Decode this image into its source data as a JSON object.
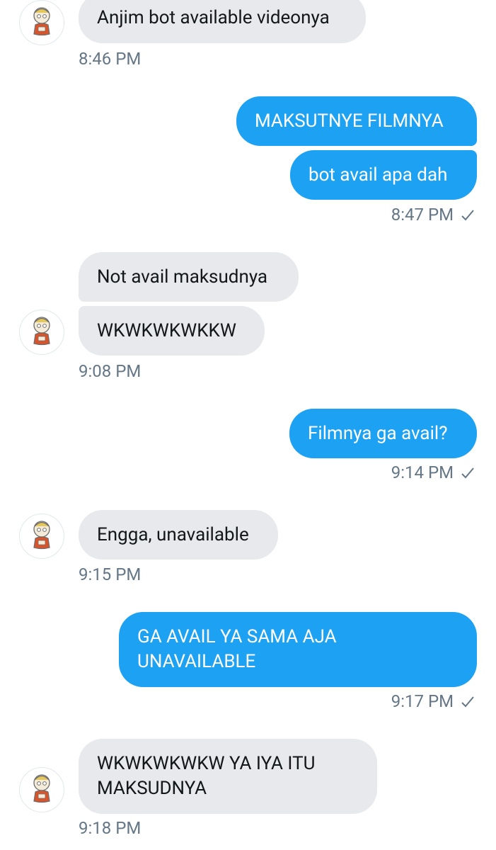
{
  "messages": [
    {
      "id": "m1",
      "side": "received",
      "text": "Anjim bot available videonya"
    },
    {
      "id": "m2",
      "side": "sent",
      "text": "MAKSUTNYE FILMNYA"
    },
    {
      "id": "m3",
      "side": "sent",
      "text": "bot avail apa dah"
    },
    {
      "id": "m4",
      "side": "received",
      "text": "Not avail maksudnya"
    },
    {
      "id": "m5",
      "side": "received",
      "text": "WKWKWKWKKW"
    },
    {
      "id": "m6",
      "side": "sent",
      "text": "Filmnya ga avail?"
    },
    {
      "id": "m7",
      "side": "received",
      "text": "Engga, unavailable"
    },
    {
      "id": "m8",
      "side": "sent",
      "text": "GA AVAIL YA SAMA AJA\nUNAVAILABLE"
    },
    {
      "id": "m9",
      "side": "received",
      "text": "WKWKWKWKW YA IYA ITU\nMAKSUDNYA"
    }
  ],
  "timestamps": [
    {
      "text": "8:46 PM",
      "side": "received",
      "read_check": false
    },
    {
      "text": "8:47 PM",
      "side": "sent",
      "read_check": true
    },
    {
      "text": "9:08 PM",
      "side": "received",
      "read_check": false
    },
    {
      "text": "9:14 PM",
      "side": "sent",
      "read_check": true
    },
    {
      "text": "9:15 PM",
      "side": "received",
      "read_check": false
    },
    {
      "text": "9:17 PM",
      "side": "sent",
      "read_check": true
    },
    {
      "text": "9:18 PM",
      "side": "received",
      "read_check": false
    }
  ],
  "icons": {
    "avatar": "avatar-icon",
    "check": "check-icon"
  },
  "colors": {
    "sent_bubble": "#1da1f2",
    "received_bubble": "#e7e9ec",
    "timestamp": "#657786",
    "received_text": "#14171a",
    "sent_text": "#ffffff"
  }
}
